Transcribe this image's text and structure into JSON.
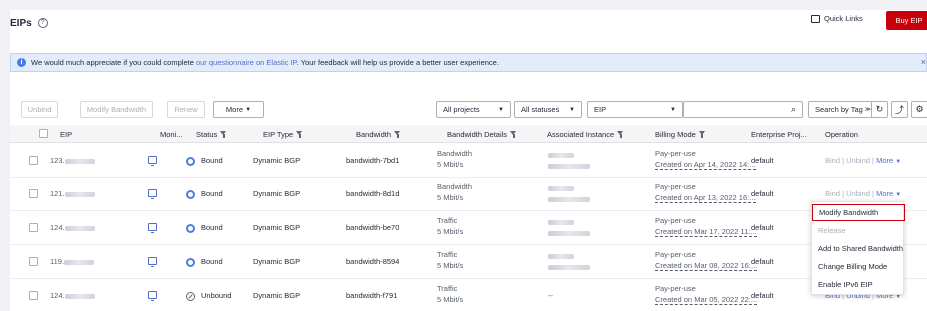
{
  "header": {
    "title": "EIPs",
    "help_icon": "help-circle-icon",
    "quick_links": "Quick Links",
    "buy": "Buy EIP"
  },
  "banner": {
    "prefix": "We would much appreciate if you could complete ",
    "link": "our questionnaire on Elastic IP",
    "suffix": ". Your feedback will help us provide a better user experience.",
    "close": "×"
  },
  "toolbar": {
    "unbind": "Unbind",
    "modify": "Modify Bandwidth",
    "renew": "Renew",
    "more": "More",
    "projects": "All projects",
    "statuses": "All statuses",
    "type": "EIP",
    "search_tag": "Search by Tag",
    "icons": [
      "search-icon",
      "refresh-icon",
      "export-icon",
      "settings-icon"
    ]
  },
  "columns": [
    "EIP",
    "Moni...",
    "Status",
    "EIP Type",
    "Bandwidth",
    "Bandwidth Details",
    "Associated Instance",
    "Billing Mode",
    "Enterprise Proj...",
    "Operation"
  ],
  "rows": [
    {
      "eip": "123.",
      "status": "Bound",
      "type": "Dynamic BGP",
      "bandwidth": "bandwidth-7bd1",
      "detail1": "Bandwidth",
      "detail2": "5 Mbit/s",
      "billing1": "Pay-per-use",
      "billing2": "Created on Apr 14, 2022 14:...",
      "project": "default",
      "op_state": "disabled"
    },
    {
      "eip": "121.",
      "status": "Bound",
      "type": "Dynamic BGP",
      "bandwidth": "bandwidth-8d1d",
      "detail1": "Bandwidth",
      "detail2": "5 Mbit/s",
      "billing1": "Pay-per-use",
      "billing2": "Created on Apr 13, 2022 16:...",
      "project": "default",
      "op_state": "disabled"
    },
    {
      "eip": "124.",
      "status": "Bound",
      "type": "Dynamic BGP",
      "bandwidth": "bandwidth-be70",
      "detail1": "Traffic",
      "detail2": "5 Mbit/s",
      "billing1": "Pay-per-use",
      "billing2": "Created on Mar 17, 2022 11:...",
      "project": "default",
      "op_state": "disabled"
    },
    {
      "eip": "119.",
      "status": "Bound",
      "type": "Dynamic BGP",
      "bandwidth": "bandwidth-8594",
      "detail1": "Traffic",
      "detail2": "5 Mbit/s",
      "billing1": "Pay-per-use",
      "billing2": "Created on Mar 08, 2022 16:...",
      "project": "default",
      "op_state": "disabled"
    },
    {
      "eip": "124.",
      "status": "Unbound",
      "type": "Dynamic BGP",
      "bandwidth": "bandwidth-f791",
      "detail1": "Traffic",
      "detail2": "5 Mbit/s",
      "instance": "--",
      "billing1": "Pay-per-use",
      "billing2": "Created on Mar 05, 2022 22:...",
      "project": "default",
      "op_state": "link"
    }
  ],
  "operations": {
    "bind": "Bind",
    "unbind": "Unbind",
    "more": "More",
    "sep": "|"
  },
  "more_menu": [
    "Modify Bandwidth",
    "Release",
    "Add to Shared Bandwidth",
    "Change Billing Mode",
    "Enable IPv6 EIP"
  ],
  "colors": {
    "accent": "#526ecc",
    "buy": "#c7000b",
    "bound": "#4a7de1"
  }
}
